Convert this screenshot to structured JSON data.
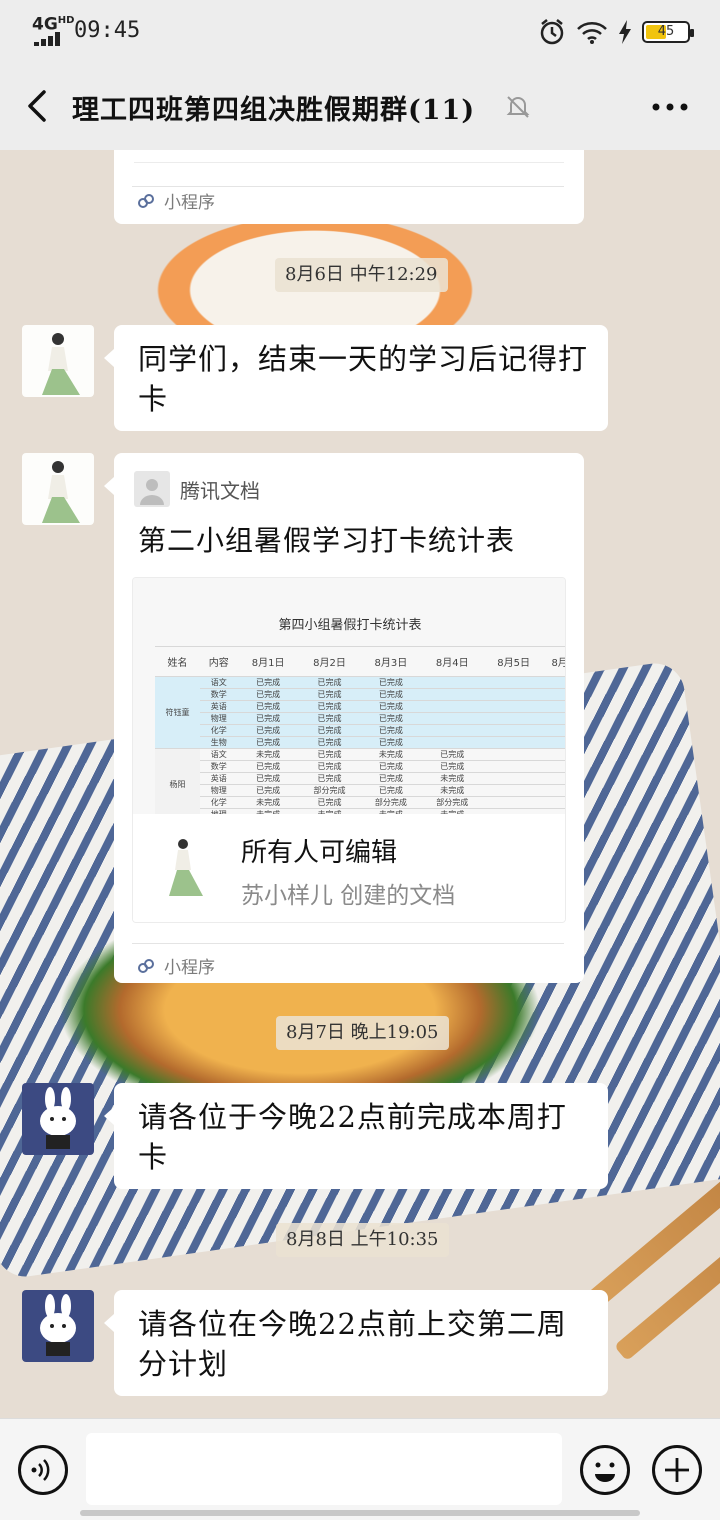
{
  "status_bar": {
    "network": "4G",
    "network_sub": "HD",
    "time": "09:45",
    "battery": "45"
  },
  "header": {
    "title": "理工四班第四组决胜假期群(11)"
  },
  "messages": {
    "mini_program_label": "小程序",
    "ts1": "8月6日 中午12:29",
    "m1_text": "同学们，结束一天的学习后记得打卡",
    "doc_source": "腾讯文档",
    "doc_title": "第二小组暑假学习打卡统计表",
    "doc_sheet_title": "第四小组暑假打卡统计表",
    "doc_edit": "所有人可编辑",
    "doc_creator": "苏小样儿 创建的文档",
    "ts2": "8月7日 晚上19:05",
    "m2_text": "请各位于今晚22点前完成本周打卡",
    "ts3": "8月8日 上午10:35",
    "m3_text": "请各位在今晚22点前上交第二周分计划"
  },
  "sheet": {
    "headers": [
      "姓名",
      "内容",
      "8月1日",
      "8月2日",
      "8月3日",
      "8月4日",
      "8月5日",
      "8月"
    ],
    "person1": "符钰童",
    "person2": "杨阳",
    "rows1": [
      [
        "语文",
        "已完成",
        "已完成",
        "已完成",
        "",
        ""
      ],
      [
        "数学",
        "已完成",
        "已完成",
        "已完成",
        "",
        ""
      ],
      [
        "英语",
        "已完成",
        "已完成",
        "已完成",
        "",
        ""
      ],
      [
        "物理",
        "已完成",
        "已完成",
        "已完成",
        "",
        ""
      ],
      [
        "化学",
        "已完成",
        "已完成",
        "已完成",
        "",
        ""
      ],
      [
        "生物",
        "已完成",
        "已完成",
        "已完成",
        "",
        ""
      ]
    ],
    "rows2": [
      [
        "语文",
        "未完成",
        "已完成",
        "未完成",
        "已完成",
        ""
      ],
      [
        "数学",
        "已完成",
        "已完成",
        "已完成",
        "已完成",
        ""
      ],
      [
        "英语",
        "已完成",
        "已完成",
        "已完成",
        "未完成",
        ""
      ],
      [
        "物理",
        "已完成",
        "部分完成",
        "已完成",
        "未完成",
        ""
      ],
      [
        "化学",
        "未完成",
        "已完成",
        "部分完成",
        "部分完成",
        ""
      ],
      [
        "地理",
        "未完成",
        "未完成",
        "未完成",
        "未完成",
        ""
      ]
    ]
  },
  "colors": {
    "bubble": "#ffffff",
    "bar": "#ededed",
    "battery": "#f1c40f"
  },
  "icons": [
    "back-arrow-icon",
    "mute-bell-icon",
    "more-icon",
    "mini-program-icon",
    "voice-icon",
    "emoji-icon",
    "plus-icon"
  ]
}
